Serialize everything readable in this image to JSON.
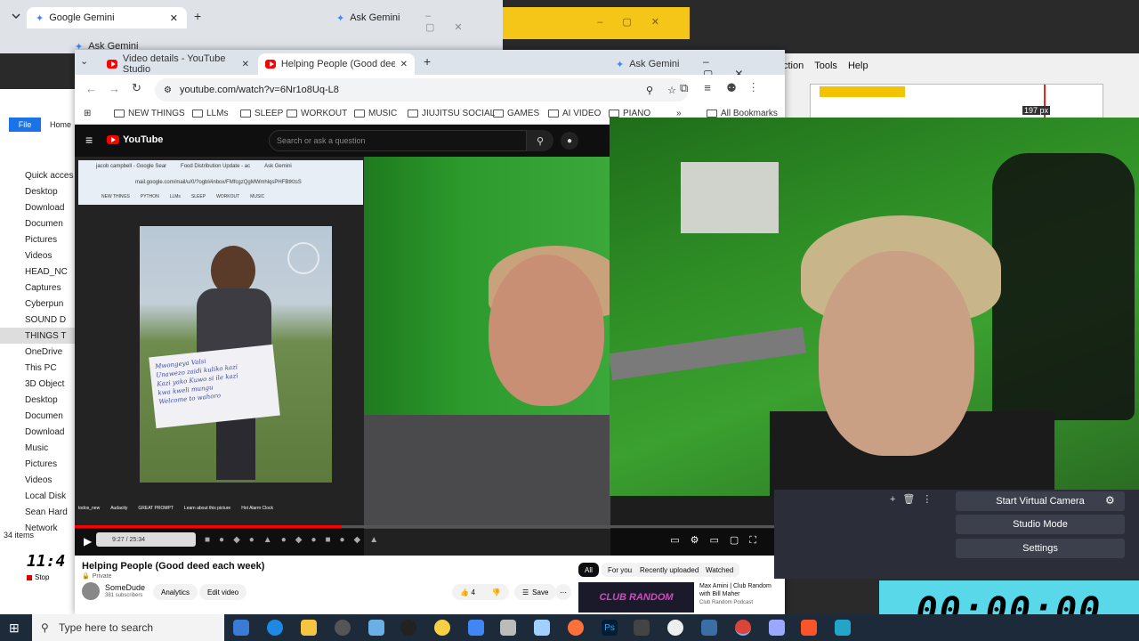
{
  "bg_chrome": {
    "tab1": "Google Gemini",
    "tab2": "Ask Gemini",
    "tab3": "Ask Gemini"
  },
  "explorer": {
    "file_tab": "File",
    "home_tab": "Home",
    "items": [
      "Quick acces",
      "Desktop",
      "Download",
      "Documen",
      "Pictures",
      "Videos",
      "HEAD_NC",
      "Captures",
      "Cyberpun",
      "SOUND D",
      "THINGS T",
      "OneDrive",
      "This PC",
      "3D Object",
      "Desktop",
      "Documen",
      "Download",
      "Music",
      "Pictures",
      "Videos",
      "Local Disk",
      "Sean Hard",
      "Network"
    ],
    "count": "34 items"
  },
  "bg_right": {
    "menu": [
      "ction",
      "Tools",
      "Help"
    ],
    "px_label": "197 px"
  },
  "main": {
    "tabs": [
      {
        "label": "Video details - YouTube Studio"
      },
      {
        "label": "Helping People (Good deed ea"
      }
    ],
    "gemini": "Ask Gemini",
    "url": "youtube.com/watch?v=6Nr1o8Uq-L8",
    "bookmarks": [
      "NEW THINGS",
      "LLMs",
      "SLEEP",
      "WORKOUT",
      "MUSIC",
      "JIUJITSU SOCIAL",
      "GAMES",
      "AI VIDEO",
      "PIANO"
    ],
    "all_bookmarks": "All Bookmarks",
    "yt_logo": "YouTube",
    "search_placeholder": "Search or ask a question",
    "inner_tabs": [
      "jacob campbell - Google Sear",
      "Food Distribution Update - ac",
      "Ask Gemini"
    ],
    "inner_url": "mail.google.com/mail/u/0/?ogbl#inbox/FMfcgzQgMWmhlqsPHFBtKtsS",
    "inner_bookmarks": [
      "NEW THINGS",
      "PYTHON",
      "LLMs",
      "SLEEP",
      "WORKOUT",
      "MUSIC"
    ],
    "sign_text": "Mwongeya Valsi\nUnawezo zaidi kuliko kazi\nKazi yako Kuwo si ile kazi\nkwa kweli mungu\nWelcome to wahoro",
    "time": "9:27 / 25:34",
    "video_title": "Helping People (Good deed each week)",
    "privacy": "Private",
    "channel": "SomeDude",
    "subs": "381 subscribers",
    "analytics": "Analytics",
    "edit_video": "Edit video",
    "likes": "4",
    "save": "Save",
    "chips": [
      "All",
      "For you",
      "Recently uploaded",
      "Watched"
    ],
    "rec_title": "Max Amini | Club Random with Bill Maher",
    "rec_channel": "Club Random Podcast",
    "rec_thumb": "CLUB RANDOM"
  },
  "desktop_icons": [
    "todos_new",
    "Audacity",
    "GREAT PROMPT",
    "Learn about this picture",
    "Hot Alarm Clock"
  ],
  "obs": {
    "start_virtual": "Start Virtual Camera",
    "studio": "Studio Mode",
    "settings": "Settings"
  },
  "timer": "00:00:00",
  "clock": "11:4",
  "stop": "Stop",
  "taskbar": {
    "search": "Type here to search"
  }
}
